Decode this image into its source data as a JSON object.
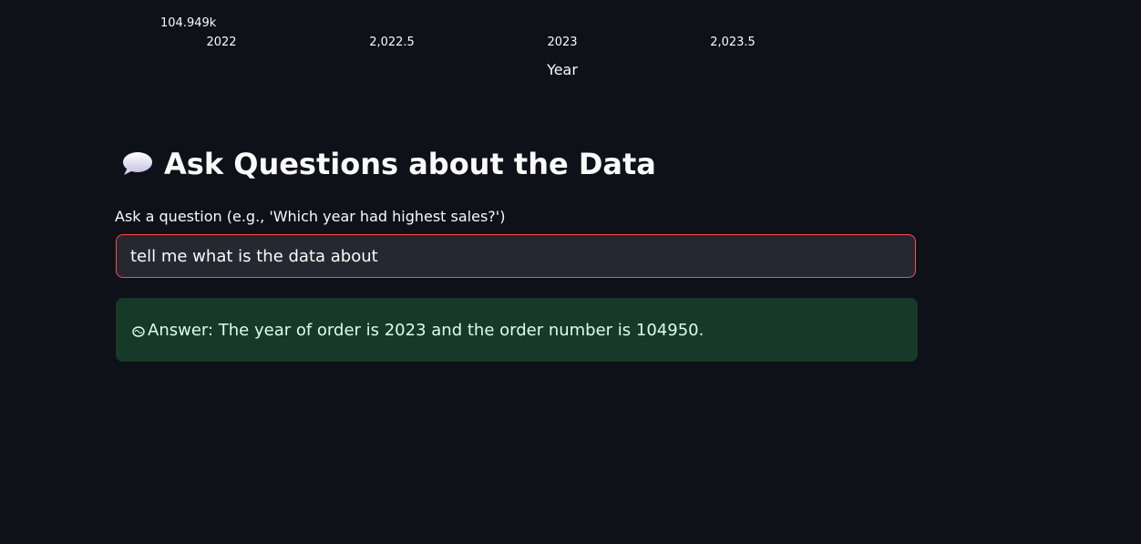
{
  "chart": {
    "y_tick": "104.949k",
    "x_ticks": [
      "2022",
      "2,022.5",
      "2023",
      "2,023.5"
    ],
    "x_label": "Year"
  },
  "chart_data": {
    "type": "line",
    "x": [
      2022,
      2022.5,
      2023,
      2023.5
    ],
    "xlabel": "Year",
    "ylabel": "",
    "yticks": [
      "104.949k"
    ]
  },
  "qa": {
    "heading": "Ask Questions about the Data",
    "heading_icon": "speech-bubble-icon",
    "question_label": "Ask a question (e.g., 'Which year had highest sales?')",
    "question_value": "tell me what is the data about",
    "answer_icon": "brain-icon",
    "answer_text": "Answer: The year of order is 2023 and the order number is 104950."
  },
  "colors": {
    "background": "#0e1117",
    "input_background": "#262730",
    "input_border": "#ff4b4b",
    "answer_background": "#173928",
    "answer_text": "#dffde9"
  }
}
